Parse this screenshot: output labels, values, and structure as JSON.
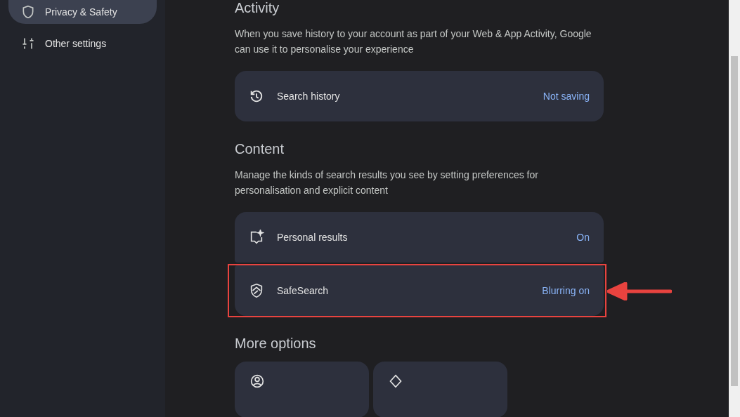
{
  "sidebar": {
    "items": [
      {
        "label": "Privacy & Safety",
        "kind": "shield",
        "selected": true
      },
      {
        "label": "Other settings",
        "kind": "sliders",
        "selected": false
      }
    ]
  },
  "sections": [
    {
      "title": "Activity",
      "description": "When you save history to your account as part of your Web & App Activity, Google can use it to personalise your experience",
      "rows": [
        {
          "kind": "history",
          "label": "Search history",
          "value": "Not saving",
          "highlighted": false
        }
      ]
    },
    {
      "title": "Content",
      "description": "Manage the kinds of search results you see by setting preferences for personalisation and explicit content",
      "rows": [
        {
          "kind": "sparkle",
          "label": "Personal results",
          "value": "On",
          "highlighted": false
        },
        {
          "kind": "shield",
          "label": "SafeSearch",
          "value": "Blurring on",
          "highlighted": true
        }
      ]
    }
  ],
  "more_options": {
    "title": "More options",
    "cards": [
      {
        "kind": "person"
      },
      {
        "kind": "diamond"
      }
    ]
  }
}
